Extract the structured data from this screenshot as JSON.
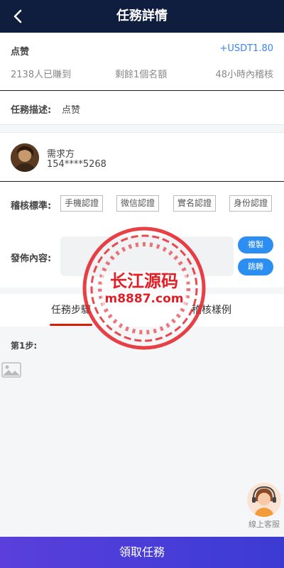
{
  "header": {
    "title": "任務詳情",
    "back_icon": "chevron-left-icon"
  },
  "task": {
    "name": "点赞",
    "reward": "+USDT1.80",
    "earned": "2138人已賺到",
    "remaining": "剩餘1個名額",
    "review_time": "48小時內稽核"
  },
  "description": {
    "label": "任務描述:",
    "value": "点赞"
  },
  "publisher": {
    "label": "需求方",
    "phone": "154****5268"
  },
  "review": {
    "label": "稽核標準:",
    "tags": [
      "手機認證",
      "微信認證",
      "實名認證",
      "身份認證"
    ]
  },
  "content": {
    "label": "發佈內容:",
    "copy_button": "複製",
    "jump_button": "跳轉"
  },
  "tabs": [
    {
      "label": "任務步驟",
      "active": true
    },
    {
      "label": "稽核樣例",
      "active": false
    }
  ],
  "steps": {
    "step1_label": "第1步:"
  },
  "customer_service": {
    "label": "線上客服"
  },
  "claim_button": "領取任務",
  "watermark": {
    "line1": "长江源码",
    "line2": "m8887.com"
  },
  "colors": {
    "header_bg": "#0f1d3f",
    "accent_blue": "#3b82f6",
    "button_blue": "#2b8ef0",
    "tab_underline": "#d81e06",
    "claim_gradient_start": "#5a3fdc",
    "claim_gradient_end": "#3b3bd4",
    "watermark_red": "#e31e24"
  }
}
